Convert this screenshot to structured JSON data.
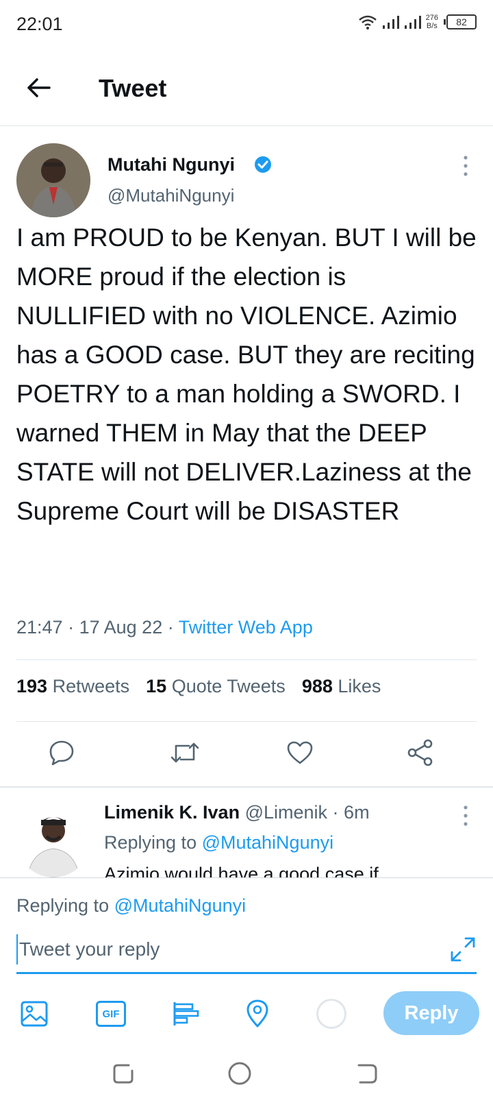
{
  "status_bar": {
    "time": "22:01",
    "net_speed_value": "276",
    "net_speed_unit": "B/s",
    "battery": "82"
  },
  "header": {
    "title": "Tweet"
  },
  "tweet": {
    "author_name": "Mutahi Ngunyi",
    "author_handle": "@MutahiNgunyi",
    "verified": true,
    "text": "I am PROUD to be Kenyan. BUT I will be MORE proud if the election is NULLIFIED with no VIOLENCE. Azimio has a GOOD case. BUT they are reciting POETRY to a man holding a SWORD. I warned THEM in May that the DEEP STATE will not DELIVER.Laziness at the Supreme Court will be DISASTER",
    "time": "21:47",
    "date": "17 Aug 22",
    "source": "Twitter Web App",
    "stats": {
      "retweets_count": "193",
      "retweets_label": "Retweets",
      "quotes_count": "15",
      "quotes_label": "Quote Tweets",
      "likes_count": "988",
      "likes_label": "Likes"
    },
    "actions": [
      "reply-icon",
      "retweet-icon",
      "like-icon",
      "share-icon"
    ]
  },
  "reply_preview": {
    "author_name": "Limenik K. Ivan",
    "author_handle": "@Limenik",
    "age": "6m",
    "replying_label": "Replying to",
    "replying_to": "@MutahiNgunyi",
    "text": "Azimio would have a good case if"
  },
  "compose": {
    "replying_label": "Replying to",
    "replying_to": "@MutahiNgunyi",
    "placeholder": "Tweet your reply",
    "gif_label": "GIF",
    "reply_button": "Reply"
  },
  "colors": {
    "accent": "#1d9bf0",
    "reply_button_disabled": "#8ecdf8",
    "secondary_text": "#536471"
  }
}
